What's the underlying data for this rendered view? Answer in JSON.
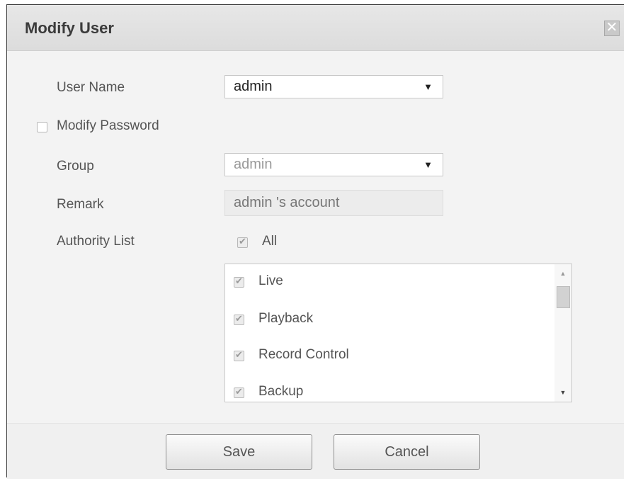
{
  "dialog": {
    "title": "Modify User",
    "close_glyph": "✕",
    "close_icon": "close-icon"
  },
  "form": {
    "user_name_label": "User Name",
    "user_name_value": "admin",
    "modify_password_label": "Modify Password",
    "modify_password_checked": false,
    "group_label": "Group",
    "group_value": "admin",
    "remark_label": "Remark",
    "remark_value": "admin 's account",
    "authority_label": "Authority List",
    "all_label": "All",
    "all_checked": true
  },
  "authority_items": [
    {
      "label": "Live",
      "checked": true
    },
    {
      "label": "Playback",
      "checked": true
    },
    {
      "label": "Record Control",
      "checked": true
    },
    {
      "label": "Backup",
      "checked": true
    }
  ],
  "buttons": {
    "save_label": "Save",
    "cancel_label": "Cancel"
  }
}
